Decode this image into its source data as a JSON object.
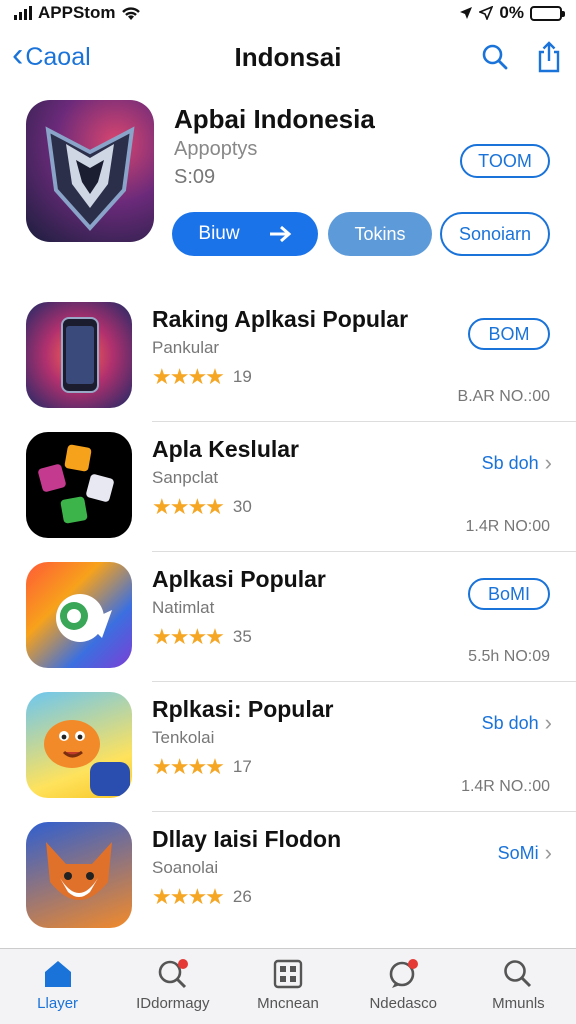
{
  "status_bar": {
    "carrier": "APPStom",
    "battery": "0%"
  },
  "nav": {
    "back_label": "Caoal",
    "title": "Indonsai"
  },
  "featured": {
    "title": "Apbai Indonesia",
    "subtitle": "Appoptys",
    "meta": "S:09",
    "get_label": "TOOM",
    "primary_label": "Biuw",
    "secondary_label": "Tokins",
    "outline_label": "Sonoiarn"
  },
  "apps": [
    {
      "title": "Raking Aplkasi Popular",
      "subtitle": "Pankular",
      "stars": "★★★★",
      "rating_count": "19",
      "action": "BOM",
      "action_type": "pill",
      "size": "B.AR NO.:00"
    },
    {
      "title": "Apla Keslular",
      "subtitle": "Sanpclat",
      "stars": "★★★★",
      "rating_count": "30",
      "action": "Sb doh",
      "action_type": "link",
      "size": "1.4R NO:00"
    },
    {
      "title": "Aplkasi Popular",
      "subtitle": "Natimlat",
      "stars": "★★★★",
      "rating_count": "35",
      "action": "BoMI",
      "action_type": "pill",
      "size": "5.5h NO:09"
    },
    {
      "title": "Rplkasi: Popular",
      "subtitle": "Tenkolai",
      "stars": "★★★★",
      "rating_count": "17",
      "action": "Sb doh",
      "action_type": "link",
      "size": "1.4R NO.:00"
    },
    {
      "title": "Dllay Iaisi Flodon",
      "subtitle": "Soanolai",
      "stars": "★★★★",
      "rating_count": "26",
      "action": "SoMi",
      "action_type": "link",
      "size": ""
    }
  ],
  "tabs": [
    {
      "label": "Llayer",
      "icon": "home-icon",
      "active": true
    },
    {
      "label": "IDdormagy",
      "icon": "search-badge-icon",
      "active": false
    },
    {
      "label": "Mncnean",
      "icon": "grid-icon",
      "active": false
    },
    {
      "label": "Ndedasco",
      "icon": "chat-badge-icon",
      "active": false
    },
    {
      "label": "Mmunls",
      "icon": "search-icon",
      "active": false
    }
  ],
  "colors": {
    "accent": "#1a73d9",
    "star": "#f5a623",
    "badge": "#e53935"
  }
}
